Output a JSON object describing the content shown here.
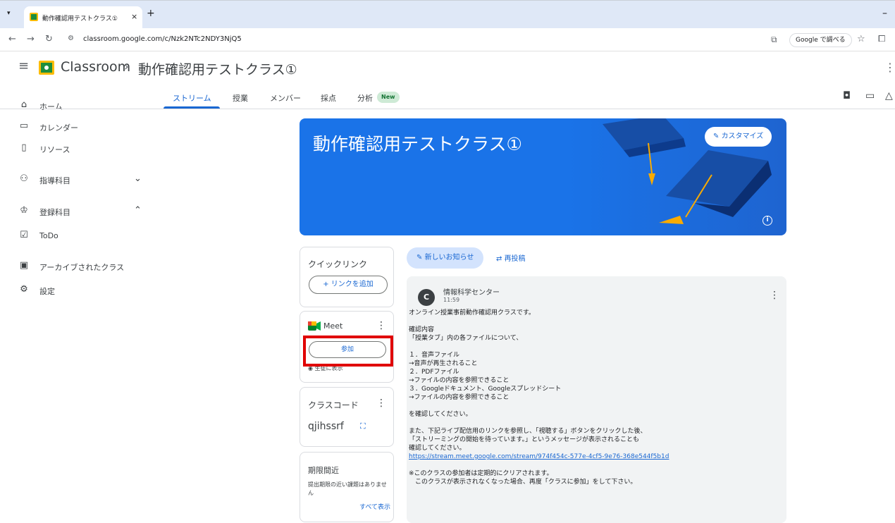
{
  "browser": {
    "tab_title": "動作確認用テストクラス①",
    "tab_close": "×",
    "new_tab": "+",
    "minimize": "–",
    "url": "classroom.google.com/c/Nzk2NTc2NDY3NjQ5",
    "google_button": "Google で調べる"
  },
  "header": {
    "app_name": "Classroom",
    "separator": "›",
    "class_name": "動作確認用テストクラス①"
  },
  "sidebar": {
    "home": "ホーム",
    "calendar": "カレンダー",
    "resources": "リソース",
    "teaching": "指導科目",
    "enrolled": "登録科目",
    "todo": "ToDo",
    "archived": "アーカイブされたクラス",
    "settings": "設定"
  },
  "tabs": {
    "stream": "ストリーム",
    "classwork": "授業",
    "people": "メンバー",
    "grades": "採点",
    "analytics": "分析",
    "new_badge": "New"
  },
  "banner": {
    "title": "動作確認用テストクラス①",
    "customize": "カスタマイズ",
    "colors": {
      "background": "#1a73e8"
    }
  },
  "quick_links": {
    "title": "クイックリンク",
    "add": "+ リンクを追加"
  },
  "meet": {
    "label": "Meet",
    "join": "参加",
    "visibility": "生徒に表示"
  },
  "class_code": {
    "title": "クラスコード",
    "code": "qjihssrf"
  },
  "upcoming": {
    "title": "期限間近",
    "message": "提出期限の近い課題はありません",
    "view_all": "すべて表示"
  },
  "stream": {
    "new_post": "新しいお知らせ",
    "repost": "再投稿"
  },
  "post": {
    "avatar": "C",
    "author": "情報科学センター",
    "time": "11:59",
    "lines": [
      "オンライン授業事前動作確認用クラスです。",
      "",
      "確認内容",
      "「授業タブ」内の各ファイルについて、",
      "",
      "１．音声ファイル",
      "→音声が再生されること",
      "２．PDFファイル",
      "→ファイルの内容を参照できること",
      "３．Googleドキュメント、Googleスプレッドシート",
      "→ファイルの内容を参照できること",
      "",
      "を確認してください。",
      "",
      "また、下記ライブ配信用のリンクを参照し、「視聴する」ボタンをクリックした後、",
      "「ストリーミングの開始を待っています。」というメッセージが表示されることも",
      "確認してください。"
    ],
    "link": "https://stream.meet.google.com/stream/974f454c-577e-4cf5-9e76-368e544f5b1d",
    "note1": "※このクラスの参加者は定期的にクリアされます。",
    "note2": "　このクラスが表示されなくなった場合、再度「クラスに参加」をして下さい。"
  }
}
